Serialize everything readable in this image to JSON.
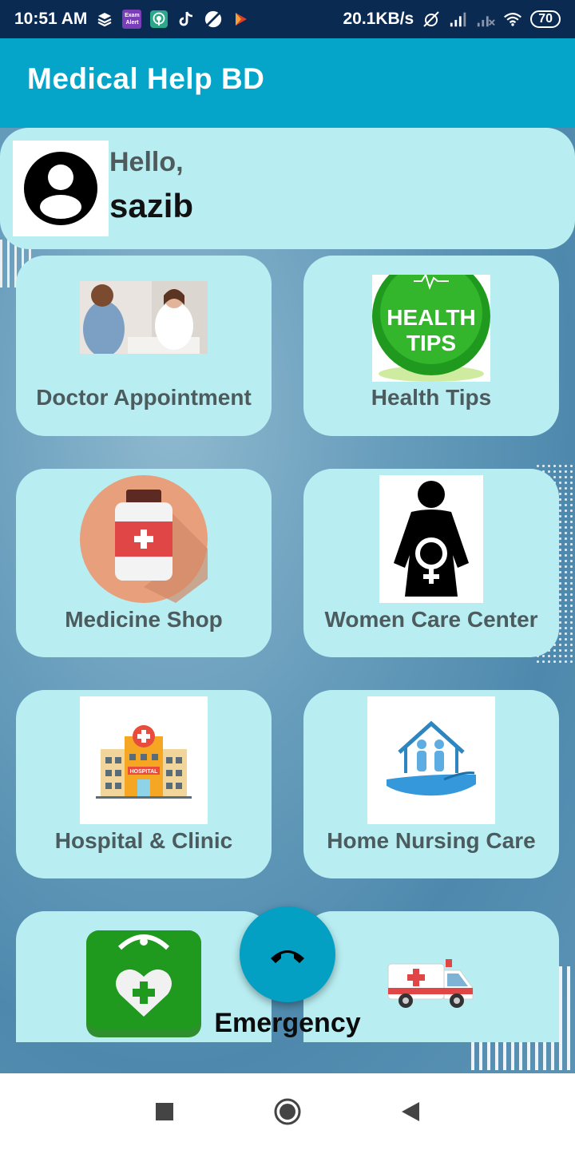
{
  "status_bar": {
    "time": "10:51 AM",
    "speed": "20.1KB/s",
    "battery": "70",
    "exam_alert": "Exam Alert",
    "icons": [
      "layers-icon",
      "exam-alert-icon",
      "podcast-icon",
      "tiktok-icon",
      "blocked-icon",
      "play-icon",
      "alarm-off-icon",
      "signal-icon",
      "signal-off-icon",
      "wifi-icon",
      "battery-icon"
    ]
  },
  "app_bar": {
    "title": "Medical Help BD"
  },
  "greeting": {
    "hello": "Hello,",
    "name": "sazib"
  },
  "tiles": [
    {
      "label": "Doctor Appointment",
      "icon": "doctor-photo"
    },
    {
      "label": "Health Tips",
      "icon": "health-tips-badge",
      "badge_line1": "HEALTH",
      "badge_line2": "TIPS"
    },
    {
      "label": "Medicine Shop",
      "icon": "medicine-bottle-icon"
    },
    {
      "label": "Women Care Center",
      "icon": "pregnant-woman-icon"
    },
    {
      "label": "Hospital & Clinic",
      "icon": "hospital-icon",
      "sign": "HOSPITAL"
    },
    {
      "label": "Home Nursing Care",
      "icon": "home-care-icon"
    },
    {
      "label": "",
      "icon": "first-aid-kit-icon"
    },
    {
      "label": "",
      "icon": "ambulance-icon"
    }
  ],
  "fab": {
    "label": "Emergency",
    "icon": "phone-icon"
  },
  "nav": {
    "icons": [
      "recents-icon",
      "home-icon",
      "back-icon"
    ]
  },
  "colors": {
    "app_bar": "#05a5c9",
    "card": "#b8eef2",
    "status_bar": "#0b2a52",
    "fab": "#03a0c4"
  }
}
